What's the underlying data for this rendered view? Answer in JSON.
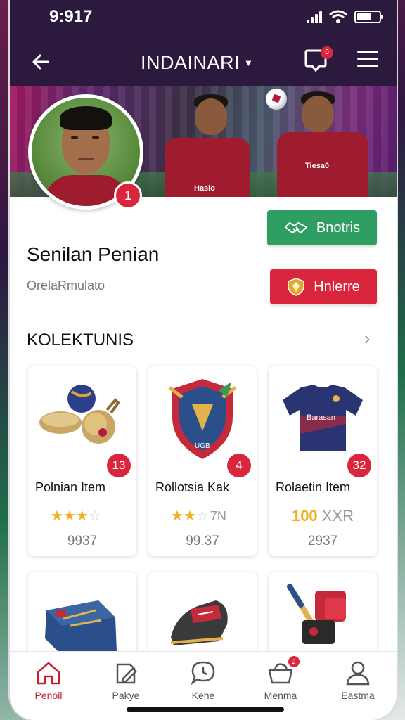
{
  "status": {
    "time": "9:917"
  },
  "header": {
    "title": "INDAINARI",
    "notification_count": "0"
  },
  "profile": {
    "name": "Senilan Penian",
    "subtitle": "OrelaRmulato",
    "rank": "1"
  },
  "actions": {
    "follow_label": "Bnotris",
    "trade_label": "Hnlerre"
  },
  "collection": {
    "title": "KOLEKTUNIS",
    "items": [
      {
        "name": "Polnian Item",
        "count": "13",
        "stars": 3,
        "max_stars": 4,
        "stars_suffix": "",
        "price": "9937"
      },
      {
        "name": "Rollotsia Kak",
        "count": "4",
        "stars": 2,
        "max_stars": 3,
        "stars_suffix": "7N",
        "price": "99.37"
      },
      {
        "name": "Rolaetin Item",
        "count": "32",
        "rating_main": "100",
        "rating_suffix": "XXR",
        "price": "2937"
      }
    ]
  },
  "tabs": [
    {
      "label": "Penoil",
      "icon": "home-icon",
      "active": true
    },
    {
      "label": "Pakye",
      "icon": "edit-icon",
      "active": false
    },
    {
      "label": "Kene",
      "icon": "chat-icon",
      "active": false
    },
    {
      "label": "Menma",
      "icon": "basket-icon",
      "active": false,
      "badge": "2"
    },
    {
      "label": "Eastma",
      "icon": "user-icon",
      "active": false
    }
  ],
  "colors": {
    "header_bg": "#2b1a3e",
    "accent_red": "#d9263d",
    "accent_green": "#2e9e62",
    "star": "#f2b01e"
  }
}
